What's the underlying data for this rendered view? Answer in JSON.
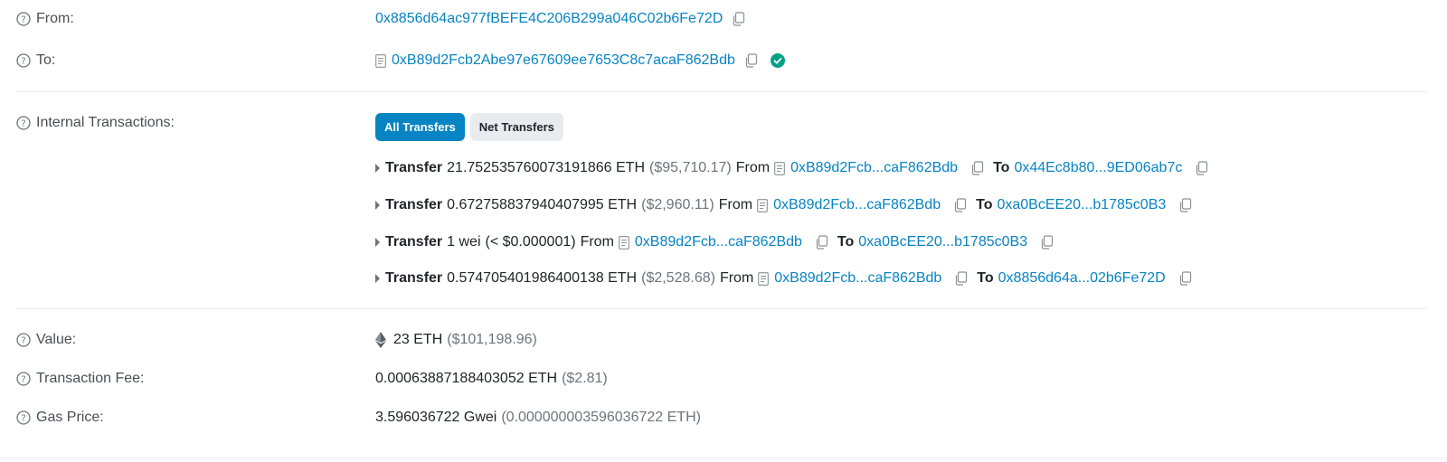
{
  "from": {
    "label": "From:",
    "address": "0x8856d64ac977fBEFE4C206B299a046C02b6Fe72D"
  },
  "to": {
    "label": "To:",
    "address": "0xB89d2Fcb2Abe97e67609ee7653C8c7acaF862Bdb"
  },
  "internal": {
    "label": "Internal Transactions:",
    "tabs": [
      "All Transfers",
      "Net Transfers"
    ],
    "transfers": [
      {
        "kw": "Transfer",
        "amount": "21.752535760073191866 ETH",
        "usd": "($95,710.17)",
        "from_kw": "From",
        "from": "0xB89d2Fcb...caF862Bdb",
        "to_kw": "To",
        "to": "0x44Ec8b80...9ED06ab7c"
      },
      {
        "kw": "Transfer",
        "amount": "0.672758837940407995 ETH",
        "usd": "($2,960.11)",
        "from_kw": "From",
        "from": "0xB89d2Fcb...caF862Bdb",
        "to_kw": "To",
        "to": "0xa0BcEE20...b1785c0B3"
      },
      {
        "kw": "Transfer",
        "amount": "1 wei",
        "usd": "(< $0.000001)",
        "from_kw": "From",
        "from": "0xB89d2Fcb...caF862Bdb",
        "to_kw": "To",
        "to": "0xa0BcEE20...b1785c0B3"
      },
      {
        "kw": "Transfer",
        "amount": "0.574705401986400138 ETH",
        "usd": "($2,528.68)",
        "from_kw": "From",
        "from": "0xB89d2Fcb...caF862Bdb",
        "to_kw": "To",
        "to": "0x8856d64a...02b6Fe72D"
      }
    ]
  },
  "value": {
    "label": "Value:",
    "amount": "23 ETH",
    "usd": "($101,198.96)"
  },
  "fee": {
    "label": "Transaction Fee:",
    "amount": "0.00063887188403052 ETH",
    "usd": "($2.81)"
  },
  "gas": {
    "label": "Gas Price:",
    "amount": "3.596036722 Gwei",
    "eth": "(0.000000003596036722 ETH)"
  },
  "colors": {
    "link": "#0784c3",
    "verified": "#00a186",
    "primary": "#0784c3"
  },
  "icons": [
    "question-circle-icon",
    "copy-icon",
    "contract-doc-icon",
    "verified-check-icon",
    "caret-right-icon",
    "ethereum-icon"
  ]
}
